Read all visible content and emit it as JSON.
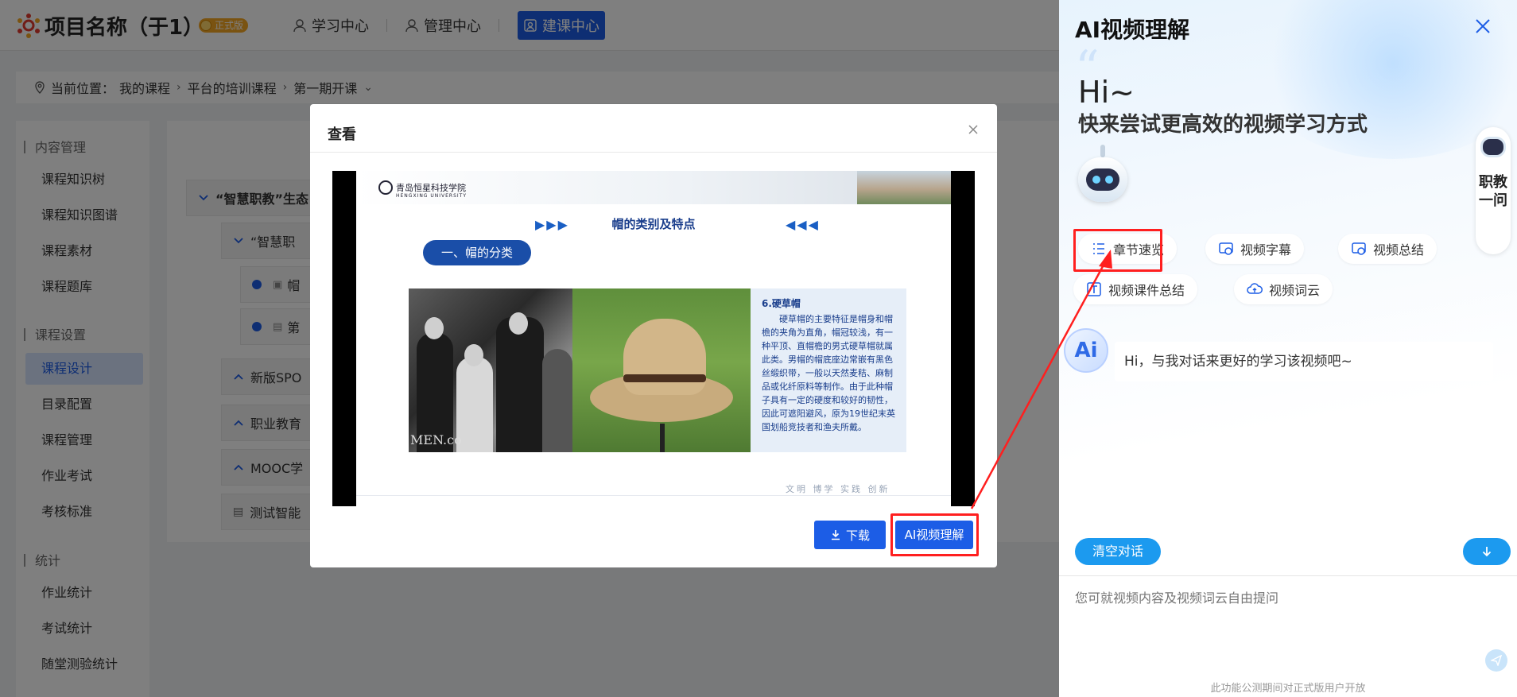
{
  "header": {
    "title": "项目名称（于1）",
    "badge": "正式版",
    "nav": [
      "学习中心",
      "管理中心",
      "建课中心"
    ]
  },
  "breadcrumb": {
    "prefix": "当前位置：",
    "items": [
      "我的课程",
      "平台的培训课程",
      "第一期开课"
    ]
  },
  "sidebar": {
    "groups": [
      {
        "title": "内容管理",
        "items": [
          "课程知识树",
          "课程知识图谱",
          "课程素材",
          "课程题库"
        ]
      },
      {
        "title": "课程设置",
        "items": [
          "课程设计",
          "目录配置",
          "课程管理",
          "作业考试",
          "考核标准"
        ]
      },
      {
        "title": "统计",
        "items": [
          "作业统计",
          "考试统计",
          "随堂测验统计"
        ]
      }
    ],
    "active": "课程设计"
  },
  "tree": {
    "rows": [
      "“智慧职教”生态",
      "“智慧职",
      "帽",
      "第",
      "新版SPO",
      "职业教育",
      "MOOC学",
      "测试智能"
    ]
  },
  "modal": {
    "title": "查看",
    "download_label": "下载",
    "ai_button_label": "AI视频理解",
    "slide": {
      "school_cn": "青岛恒星科技学院",
      "school_en": "HENGXING UNIVERSITY",
      "heading": "帽的类别及特点",
      "arrows_left": "▶▶▶",
      "arrows_right": "◀◀◀",
      "pill": "一、帽的分类",
      "photo_mark": "MEN.co",
      "text_title": "6.硬草帽",
      "text_body": "硬草帽的主要特征是帽身和帽檐的夹角为直角，帽冠较浅，有一种平顶、直帽檐的男式硬草帽就属此类。男帽的帽底座边常嵌有黑色丝缎织带，一般以天然麦秸、麻制品或化纤原料等制作。由于此种帽子具有一定的硬度和较好的韧性，因此可遮阳避风，原为19世纪末英国划船竞技者和渔夫所戴。",
      "motto": "文明 博学 实践 创新"
    }
  },
  "ai_panel": {
    "title": "AI视频理解",
    "hi": "Hi~",
    "slogan": "快来尝试更高效的视频学习方式",
    "chips": [
      "章节速览",
      "视频字幕",
      "视频总结",
      "视频课件总结",
      "视频词云"
    ],
    "avatar_text": "Ai",
    "greeting": "Hi，与我对话来更好的学习该视频吧~",
    "side_float_text": "职教一问",
    "clear_label": "清空对话",
    "input_placeholder": "您可就视频内容及视频词云自由提问",
    "footnote": "此功能公测期间对正式版用户开放",
    "colors": {
      "accent": "#1c9aef",
      "highlight": "#ff1f1f",
      "primary": "#1c5de6"
    }
  }
}
